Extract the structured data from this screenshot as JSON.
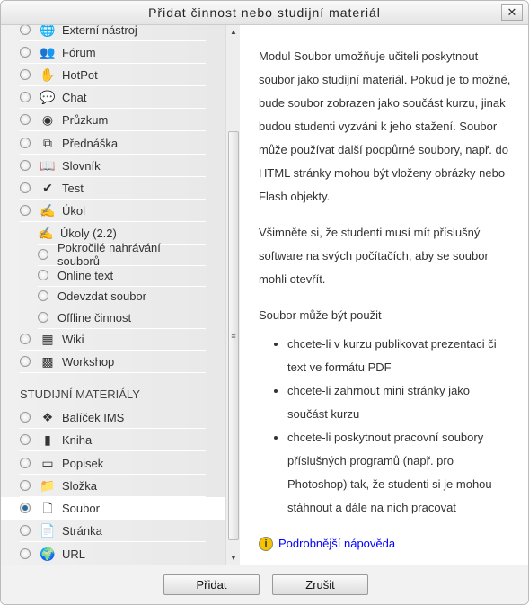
{
  "dialog": {
    "title": "Přidat činnost nebo studijní materiál",
    "close": "✕"
  },
  "activities": [
    {
      "label": "Externí nástroj",
      "icon": "globe-icon",
      "glyph": "🌐"
    },
    {
      "label": "Fórum",
      "icon": "forum-icon",
      "glyph": "👥"
    },
    {
      "label": "HotPot",
      "icon": "hotpot-icon",
      "glyph": "✋"
    },
    {
      "label": "Chat",
      "icon": "chat-icon",
      "glyph": "💬"
    },
    {
      "label": "Průzkum",
      "icon": "survey-icon",
      "glyph": "◉"
    },
    {
      "label": "Přednáška",
      "icon": "lesson-icon",
      "glyph": "⧉"
    },
    {
      "label": "Slovník",
      "icon": "glossary-icon",
      "glyph": "📖"
    },
    {
      "label": "Test",
      "icon": "quiz-icon",
      "glyph": "✔"
    },
    {
      "label": "Úkol",
      "icon": "assignment-icon",
      "glyph": "✍"
    }
  ],
  "assignment_sub": {
    "label": "Úkoly (2.2)",
    "icon": "assignment-icon",
    "glyph": "✍",
    "items": [
      "Pokročilé nahrávání souborů",
      "Online text",
      "Odevzdat soubor",
      "Offline činnost"
    ]
  },
  "activities2": [
    {
      "label": "Wiki",
      "icon": "wiki-icon",
      "glyph": "▦"
    },
    {
      "label": "Workshop",
      "icon": "workshop-icon",
      "glyph": "▩"
    }
  ],
  "resources_heading": "STUDIJNÍ MATERIÁLY",
  "resources": [
    {
      "label": "Balíček IMS",
      "icon": "ims-package-icon",
      "glyph": "❖"
    },
    {
      "label": "Kniha",
      "icon": "book-icon",
      "glyph": "▮"
    },
    {
      "label": "Popisek",
      "icon": "label-icon",
      "glyph": "▭"
    },
    {
      "label": "Složka",
      "icon": "folder-icon",
      "glyph": "📁"
    },
    {
      "label": "Soubor",
      "icon": "file-icon",
      "glyph": "🗋",
      "selected": true
    },
    {
      "label": "Stránka",
      "icon": "page-icon",
      "glyph": "📄"
    },
    {
      "label": "URL",
      "icon": "url-icon",
      "glyph": "🌍"
    }
  ],
  "description": {
    "p1": "Modul Soubor umožňuje učiteli poskytnout soubor jako studijní materiál. Pokud je to možné, bude soubor zobrazen jako součást kurzu, jinak budou studenti vyzváni k jeho stažení. Soubor může používat další podpůrné soubory, např. do HTML stránky mohou být vloženy obrázky nebo Flash objekty.",
    "p2": "Všimněte si, že studenti musí mít příslušný software na svých počítačích, aby se soubor mohli otevřít.",
    "p3": "Soubor může být použit",
    "bullets": [
      "chcete-li v kurzu publikovat prezentaci či text ve formátu PDF",
      "chcete-li zahrnout mini stránky jako součást kurzu",
      "chcete-li poskytnout pracovní soubory příslušných programů (např. pro Photoshop) tak, že studenti si je mohou stáhnout a dále na nich pracovat"
    ],
    "help_link": "Podrobnější nápověda"
  },
  "buttons": {
    "add": "Přidat",
    "cancel": "Zrušit"
  }
}
